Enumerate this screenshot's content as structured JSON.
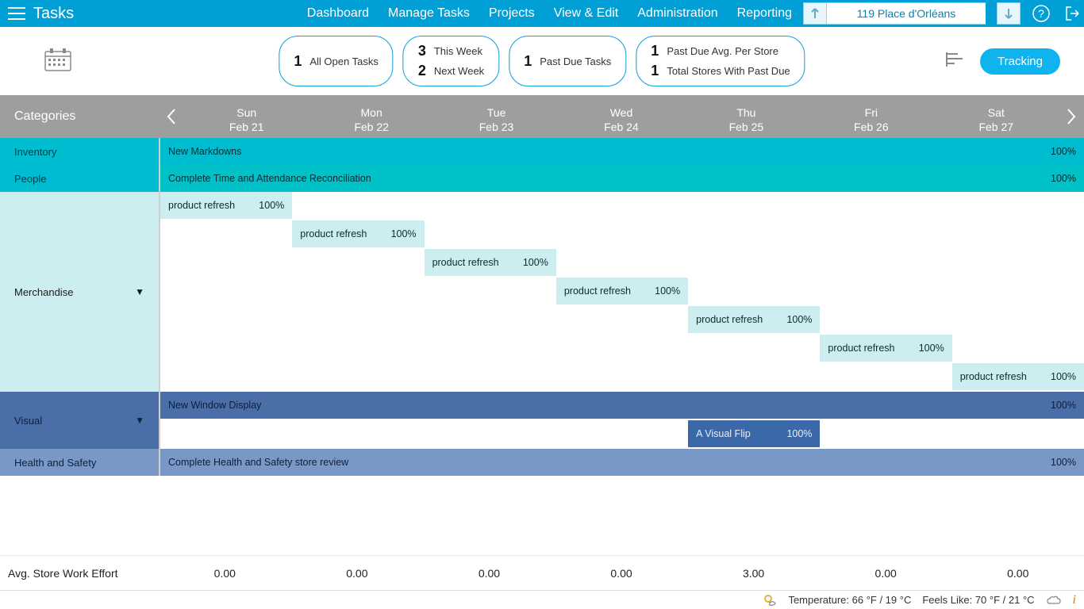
{
  "header": {
    "app_title": "Tasks",
    "nav": [
      "Dashboard",
      "Manage Tasks",
      "Projects",
      "View & Edit",
      "Administration",
      "Reporting"
    ],
    "location": "119 Place d'Orléans"
  },
  "summary": {
    "pills": [
      {
        "lines": [
          {
            "n": "1",
            "label": "All Open Tasks"
          }
        ]
      },
      {
        "lines": [
          {
            "n": "3",
            "label": "This Week"
          },
          {
            "n": "2",
            "label": "Next Week"
          }
        ]
      },
      {
        "lines": [
          {
            "n": "1",
            "label": "Past Due Tasks"
          }
        ]
      },
      {
        "lines": [
          {
            "n": "1",
            "label": "Past Due Avg. Per Store"
          },
          {
            "n": "1",
            "label": "Total Stores With Past Due"
          }
        ]
      }
    ],
    "tracking_label": "Tracking"
  },
  "columns": {
    "categories_label": "Categories",
    "days": [
      {
        "dow": "Sun",
        "date": "Feb 21"
      },
      {
        "dow": "Mon",
        "date": "Feb 22"
      },
      {
        "dow": "Tue",
        "date": "Feb 23"
      },
      {
        "dow": "Wed",
        "date": "Feb 24"
      },
      {
        "dow": "Thu",
        "date": "Feb 25"
      },
      {
        "dow": "Fri",
        "date": "Feb 26"
      },
      {
        "dow": "Sat",
        "date": "Feb 27"
      }
    ]
  },
  "categories": {
    "inventory": "Inventory",
    "people": "People",
    "merchandise": "Merchandise",
    "visual": "Visual",
    "health": "Health and Safety"
  },
  "bars": {
    "inv": {
      "label": "New Markdowns",
      "pct": "100%"
    },
    "ppl": {
      "label": "Complete Time and Attendance Reconciliation",
      "pct": "100%"
    },
    "mr0": {
      "label": "product refresh",
      "pct": "100%"
    },
    "mr1": {
      "label": "product refresh",
      "pct": "100%"
    },
    "mr2": {
      "label": "product refresh",
      "pct": "100%"
    },
    "mr3": {
      "label": "product refresh",
      "pct": "100%"
    },
    "mr4": {
      "label": "product refresh",
      "pct": "100%"
    },
    "mr5": {
      "label": "product refresh",
      "pct": "100%"
    },
    "mr6": {
      "label": "product refresh",
      "pct": "100%"
    },
    "vis_full": {
      "label": "New Window Display",
      "pct": "100%"
    },
    "vis_flip": {
      "label": "A Visual Flip",
      "pct": "100%"
    },
    "hs": {
      "label": "Complete Health and Safety store review",
      "pct": "100%"
    }
  },
  "effort": {
    "label": "Avg. Store Work Effort",
    "values": [
      "0.00",
      "0.00",
      "0.00",
      "0.00",
      "3.00",
      "0.00",
      "0.00"
    ]
  },
  "status": {
    "temp": "Temperature: 66 °F / 19 °C",
    "feels": "Feels Like: 70 °F / 21 °C"
  }
}
